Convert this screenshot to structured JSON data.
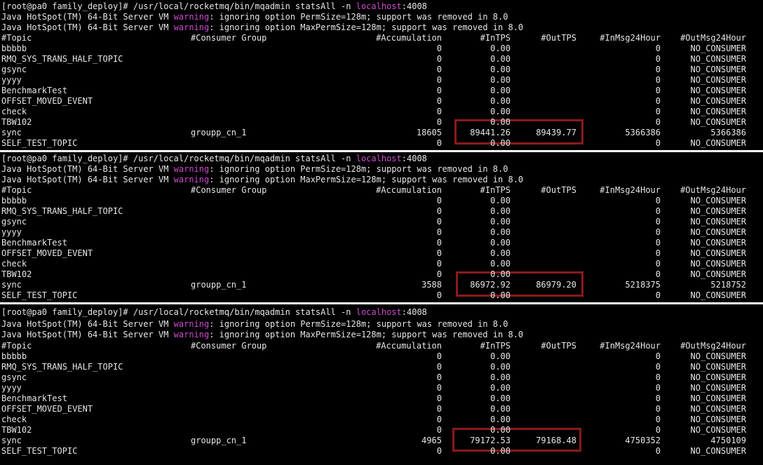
{
  "colors": {
    "background": "#000000",
    "text": "#e6e6e6",
    "highlight": "#d04ad0",
    "box_border": "#8b1a1a",
    "separator": "#ffffff"
  },
  "panels": [
    {
      "prompt": "[root@pa0 family_deploy]# /usr/local/rocketmq/bin/mqadmin statsAll -n ",
      "prompt_host": "localhost",
      "prompt_port": ":4008",
      "warn1_pre": "Java HotSpot(TM) 64-Bit Server VM ",
      "warn_word": "warning",
      "warn1_post": ": ignoring option PermSize=128m; support was removed in 8.0",
      "warn2_pre": "Java HotSpot(TM) 64-Bit Server VM ",
      "warn2_post": ": ignoring option MaxPermSize=128m; support was removed in 8.0",
      "headers": {
        "topic": "#Topic",
        "group": "#Consumer Group",
        "acc": "#Accumulation",
        "intps": "#InTPS",
        "outtps": "#OutTPS",
        "in24": "#InMsg24Hour",
        "out24": "#OutMsg24Hour"
      },
      "rows": [
        {
          "topic": "bbbbb",
          "group": "",
          "acc": "0",
          "intps": "0.00",
          "outtps": "",
          "in24": "0",
          "out24": "NO_CONSUMER"
        },
        {
          "topic": "RMQ_SYS_TRANS_HALF_TOPIC",
          "group": "",
          "acc": "0",
          "intps": "0.00",
          "outtps": "",
          "in24": "0",
          "out24": "NO_CONSUMER"
        },
        {
          "topic": "gsync",
          "group": "",
          "acc": "0",
          "intps": "0.00",
          "outtps": "",
          "in24": "0",
          "out24": "NO_CONSUMER"
        },
        {
          "topic": "yyyy",
          "group": "",
          "acc": "0",
          "intps": "0.00",
          "outtps": "",
          "in24": "0",
          "out24": "NO_CONSUMER"
        },
        {
          "topic": "BenchmarkTest",
          "group": "",
          "acc": "0",
          "intps": "0.00",
          "outtps": "",
          "in24": "0",
          "out24": "NO_CONSUMER"
        },
        {
          "topic": "OFFSET_MOVED_EVENT",
          "group": "",
          "acc": "0",
          "intps": "0.00",
          "outtps": "",
          "in24": "0",
          "out24": "NO_CONSUMER"
        },
        {
          "topic": "check",
          "group": "",
          "acc": "0",
          "intps": "0.00",
          "outtps": "",
          "in24": "0",
          "out24": "NO_CONSUMER"
        },
        {
          "topic": "TBW102",
          "group": "",
          "acc": "0",
          "intps": "0.00",
          "outtps": "",
          "in24": "0",
          "out24": "NO_CONSUMER"
        },
        {
          "topic": "sync",
          "group": "groupp_cn_1",
          "acc": "18605",
          "intps": "89441.26",
          "outtps": "89439.77",
          "in24": "5366386",
          "out24": "5366386"
        },
        {
          "topic": "SELF_TEST_TOPIC",
          "group": "",
          "acc": "0",
          "intps": "0.00",
          "outtps": "",
          "in24": "0",
          "out24": "NO_CONSUMER"
        }
      ]
    },
    {
      "prompt": "[root@pa0 family_deploy]# /usr/local/rocketmq/bin/mqadmin statsAll -n ",
      "prompt_host": "localhost",
      "prompt_port": ":4008",
      "warn1_pre": "Java HotSpot(TM) 64-Bit Server VM ",
      "warn_word": "warning",
      "warn1_post": ": ignoring option PermSize=128m; support was removed in 8.0",
      "warn2_pre": "Java HotSpot(TM) 64-Bit Server VM ",
      "warn2_post": ": ignoring option MaxPermSize=128m; support was removed in 8.0",
      "headers": {
        "topic": "#Topic",
        "group": "#Consumer Group",
        "acc": "#Accumulation",
        "intps": "#InTPS",
        "outtps": "#OutTPS",
        "in24": "#InMsg24Hour",
        "out24": "#OutMsg24Hour"
      },
      "rows": [
        {
          "topic": "bbbbb",
          "group": "",
          "acc": "0",
          "intps": "0.00",
          "outtps": "",
          "in24": "0",
          "out24": "NO_CONSUMER"
        },
        {
          "topic": "RMQ_SYS_TRANS_HALF_TOPIC",
          "group": "",
          "acc": "0",
          "intps": "0.00",
          "outtps": "",
          "in24": "0",
          "out24": "NO_CONSUMER"
        },
        {
          "topic": "gsync",
          "group": "",
          "acc": "0",
          "intps": "0.00",
          "outtps": "",
          "in24": "0",
          "out24": "NO_CONSUMER"
        },
        {
          "topic": "yyyy",
          "group": "",
          "acc": "0",
          "intps": "0.00",
          "outtps": "",
          "in24": "0",
          "out24": "NO_CONSUMER"
        },
        {
          "topic": "BenchmarkTest",
          "group": "",
          "acc": "0",
          "intps": "0.00",
          "outtps": "",
          "in24": "0",
          "out24": "NO_CONSUMER"
        },
        {
          "topic": "OFFSET_MOVED_EVENT",
          "group": "",
          "acc": "0",
          "intps": "0.00",
          "outtps": "",
          "in24": "0",
          "out24": "NO_CONSUMER"
        },
        {
          "topic": "check",
          "group": "",
          "acc": "0",
          "intps": "0.00",
          "outtps": "",
          "in24": "0",
          "out24": "NO_CONSUMER"
        },
        {
          "topic": "TBW102",
          "group": "",
          "acc": "0",
          "intps": "0.00",
          "outtps": "",
          "in24": "0",
          "out24": "NO_CONSUMER"
        },
        {
          "topic": "sync",
          "group": "groupp_cn_1",
          "acc": "3588",
          "intps": "86972.92",
          "outtps": "86979.20",
          "in24": "5218375",
          "out24": "5218752"
        },
        {
          "topic": "SELF_TEST_TOPIC",
          "group": "",
          "acc": "0",
          "intps": "0.00",
          "outtps": "",
          "in24": "0",
          "out24": "NO_CONSUMER"
        }
      ]
    },
    {
      "prompt": "[root@pa0 family_deploy]# /usr/local/rocketmq/bin/mqadmin statsAll -n ",
      "prompt_host": "localhost",
      "prompt_port": ":4008",
      "warn1_pre": "Java HotSpot(TM) 64-Bit Server VM ",
      "warn_word": "warning",
      "warn1_post": ": ignoring option PermSize=128m; support was removed in 8.0",
      "warn2_pre": "Java HotSpot(TM) 64-Bit Server VM ",
      "warn2_post": ": ignoring option MaxPermSize=128m; support was removed in 8.0",
      "headers": {
        "topic": "#Topic",
        "group": "#Consumer Group",
        "acc": "#Accumulation",
        "intps": "#InTPS",
        "outtps": "#OutTPS",
        "in24": "#InMsg24Hour",
        "out24": "#OutMsg24Hour"
      },
      "rows": [
        {
          "topic": "bbbbb",
          "group": "",
          "acc": "0",
          "intps": "0.00",
          "outtps": "",
          "in24": "0",
          "out24": "NO_CONSUMER"
        },
        {
          "topic": "RMQ_SYS_TRANS_HALF_TOPIC",
          "group": "",
          "acc": "0",
          "intps": "0.00",
          "outtps": "",
          "in24": "0",
          "out24": "NO_CONSUMER"
        },
        {
          "topic": "gsync",
          "group": "",
          "acc": "0",
          "intps": "0.00",
          "outtps": "",
          "in24": "0",
          "out24": "NO_CONSUMER"
        },
        {
          "topic": "yyyy",
          "group": "",
          "acc": "0",
          "intps": "0.00",
          "outtps": "",
          "in24": "0",
          "out24": "NO_CONSUMER"
        },
        {
          "topic": "BenchmarkTest",
          "group": "",
          "acc": "0",
          "intps": "0.00",
          "outtps": "",
          "in24": "0",
          "out24": "NO_CONSUMER"
        },
        {
          "topic": "OFFSET_MOVED_EVENT",
          "group": "",
          "acc": "0",
          "intps": "0.00",
          "outtps": "",
          "in24": "0",
          "out24": "NO_CONSUMER"
        },
        {
          "topic": "check",
          "group": "",
          "acc": "0",
          "intps": "0.00",
          "outtps": "",
          "in24": "0",
          "out24": "NO_CONSUMER"
        },
        {
          "topic": "TBW102",
          "group": "",
          "acc": "0",
          "intps": "0.00",
          "outtps": "",
          "in24": "0",
          "out24": "NO_CONSUMER"
        },
        {
          "topic": "sync",
          "group": "groupp_cn_1",
          "acc": "4965",
          "intps": "79172.53",
          "outtps": "79168.48",
          "in24": "4750352",
          "out24": "4750109"
        },
        {
          "topic": "SELF_TEST_TOPIC",
          "group": "",
          "acc": "0",
          "intps": "0.00",
          "outtps": "",
          "in24": "0",
          "out24": "NO_CONSUMER"
        }
      ]
    }
  ]
}
